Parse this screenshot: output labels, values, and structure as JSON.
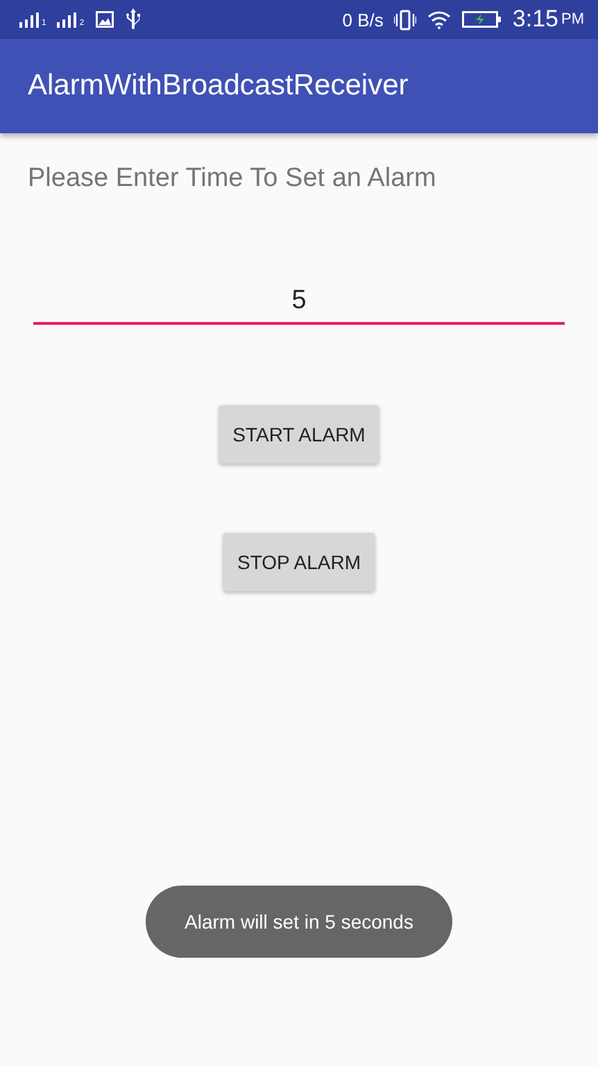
{
  "status_bar": {
    "sim_labels": [
      "1",
      "2"
    ],
    "speed": "0 B/s",
    "time": "3:15",
    "ampm": "PM"
  },
  "app_bar": {
    "title": "AlarmWithBroadcastReceiver"
  },
  "prompt": "Please Enter Time To Set an Alarm",
  "time_field": {
    "value": "5"
  },
  "buttons": [
    "START ALARM",
    "STOP ALARM"
  ],
  "toast": "Alarm will set in 5 seconds"
}
